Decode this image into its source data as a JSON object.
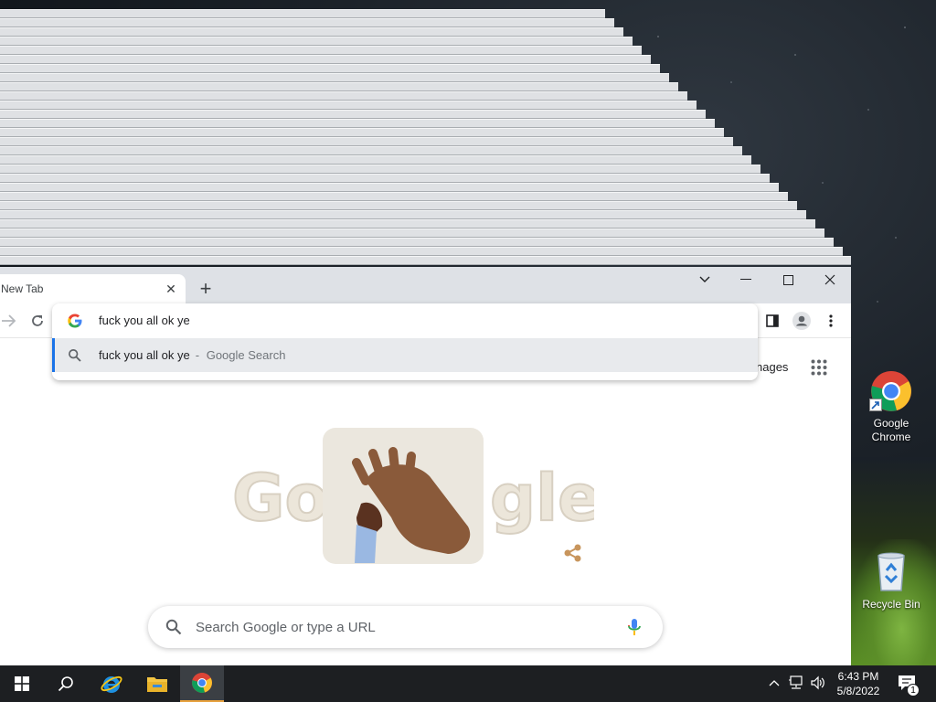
{
  "browser": {
    "tab": {
      "title": "New Tab",
      "close_icon": "close-icon"
    },
    "new_tab_icon": "plus-icon",
    "window_controls": [
      "chevron-down-icon",
      "minimize-icon",
      "maximize-icon",
      "close-icon"
    ],
    "toolbar": {
      "forward_icon": "arrow-right-icon",
      "reload_icon": "reload-icon",
      "side_panel_icon": "side-panel-icon",
      "profile_icon": "profile-icon",
      "menu_icon": "kebab-menu-icon"
    },
    "omnibox": {
      "value": "fuck you all ok ye",
      "suggestion": {
        "query": "fuck you all ok ye",
        "separator": "-",
        "source": "Google Search"
      }
    },
    "ntp": {
      "images_link": "nages",
      "apps_icon": "apps-grid-icon",
      "doodle": {
        "letters": "Google",
        "description_icon": "doodle-hands-icon"
      },
      "share_icon": "share-icon",
      "search_placeholder": "Search Google or type a URL",
      "mic_icon": "mic-icon"
    }
  },
  "desktop": {
    "icons": [
      {
        "label_line1": "Google",
        "label_line2": "Chrome",
        "icon": "chrome-icon"
      },
      {
        "label_line1": "Recycle Bin",
        "icon": "recycle-bin-icon"
      }
    ]
  },
  "taskbar": {
    "apps": [
      "windows-start-icon",
      "search-icon",
      "internet-explorer-icon",
      "file-explorer-icon",
      "chrome-icon"
    ],
    "active_app": "chrome-icon",
    "tray": [
      "chevron-up-icon",
      "network-icon",
      "volume-icon"
    ],
    "time": "6:43 PM",
    "date": "5/8/2022",
    "notifications_count": "1"
  },
  "colors": {
    "accent": "#1a73e8",
    "titlebar": "#dee1e6",
    "taskbar": "#1d1f22",
    "active_task": "#e7a13d"
  }
}
